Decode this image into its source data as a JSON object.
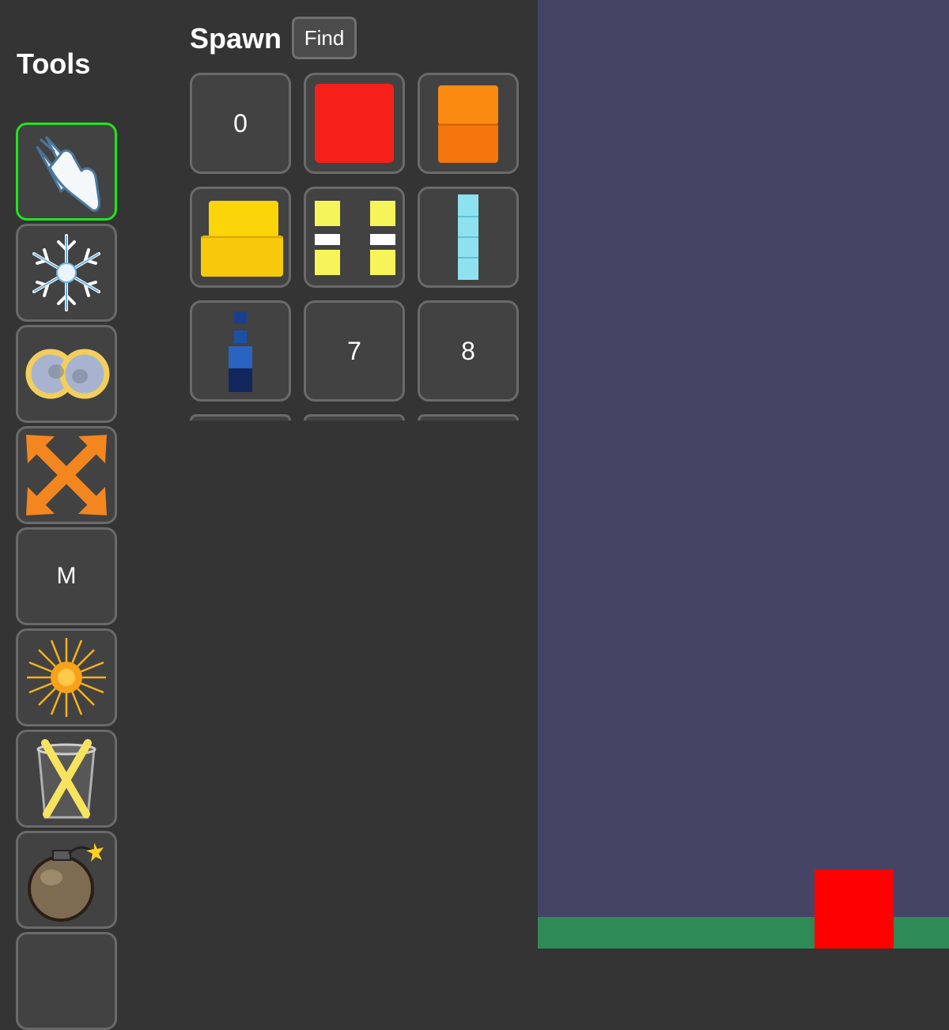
{
  "tools": {
    "title": "Tools",
    "items": [
      {
        "name": "hand-tool",
        "icon": "hand-icon",
        "selected": true
      },
      {
        "name": "freeze-tool",
        "icon": "snowflake-icon",
        "selected": false
      },
      {
        "name": "link-tool",
        "icon": "infinity-rings-icon",
        "selected": false
      },
      {
        "name": "resize-tool",
        "icon": "expand-arrows-icon",
        "selected": false
      },
      {
        "name": "m-tool",
        "label": "M",
        "selected": false
      },
      {
        "name": "explode-burst-tool",
        "icon": "burst-icon",
        "selected": false
      },
      {
        "name": "delete-tool",
        "icon": "trash-x-icon",
        "selected": false
      },
      {
        "name": "bomb-tool",
        "icon": "bomb-icon",
        "selected": false
      }
    ]
  },
  "spawn": {
    "title": "Spawn",
    "find_label": "Find",
    "items": [
      {
        "label": "0"
      },
      {
        "icon": "red-block-icon"
      },
      {
        "icon": "orange-stack-icon"
      },
      {
        "icon": "yellow-stack-icon"
      },
      {
        "icon": "yellow-pair-icon"
      },
      {
        "icon": "cyan-column-icon"
      },
      {
        "icon": "blue-tower-icon"
      },
      {
        "label": "7"
      },
      {
        "label": "8"
      }
    ]
  },
  "colors": {
    "panel_bg": "#343434",
    "world_bg": "#454465",
    "ground": "#2e8a57",
    "block": "#ff0000",
    "selected_border": "#1ee61e"
  }
}
